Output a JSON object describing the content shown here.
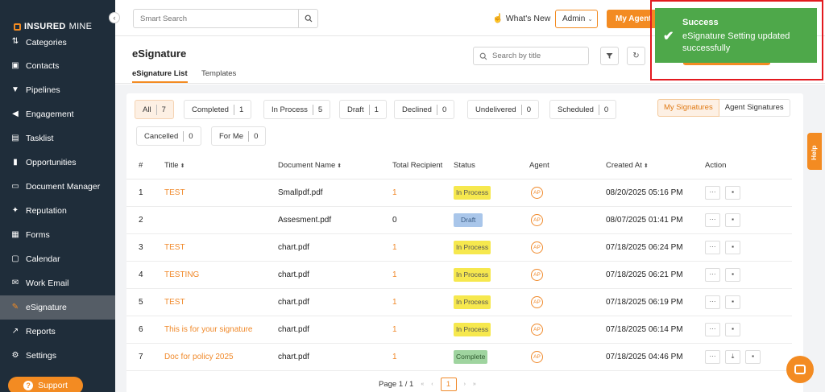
{
  "brand": {
    "name_bold": "INSURED",
    "name_light": "MINE"
  },
  "sidebar": {
    "collapse_icon": "chevron-left-icon",
    "items": [
      {
        "label": "Categories",
        "icon": "arrows-icon"
      },
      {
        "label": "Contacts",
        "icon": "contact-card-icon"
      },
      {
        "label": "Pipelines",
        "icon": "funnel-icon"
      },
      {
        "label": "Engagement",
        "icon": "megaphone-icon"
      },
      {
        "label": "Tasklist",
        "icon": "clipboard-icon"
      },
      {
        "label": "Opportunities",
        "icon": "bar-chart-icon"
      },
      {
        "label": "Document Manager",
        "icon": "folder-icon"
      },
      {
        "label": "Reputation",
        "icon": "star-person-icon"
      },
      {
        "label": "Forms",
        "icon": "form-icon"
      },
      {
        "label": "Calendar",
        "icon": "calendar-icon"
      },
      {
        "label": "Work Email",
        "icon": "envelope-icon"
      },
      {
        "label": "eSignature",
        "icon": "signature-icon",
        "active": true
      },
      {
        "label": "Reports",
        "icon": "line-chart-icon"
      },
      {
        "label": "Settings",
        "icon": "gear-icon"
      }
    ],
    "support_label": "Support"
  },
  "topbar": {
    "search_placeholder": "Smart Search",
    "whats_new": "What's New",
    "admin_select": "Admin",
    "my_agent": "My Agent"
  },
  "page": {
    "title": "eSignature",
    "tabs": [
      "eSignature List",
      "Templates"
    ],
    "search_placeholder": "Search by title"
  },
  "filters": [
    {
      "label": "All",
      "count": "7",
      "active": true
    },
    {
      "label": "Completed",
      "count": "1"
    },
    {
      "label": "In Process",
      "count": "5"
    },
    {
      "label": "Draft",
      "count": "1"
    },
    {
      "label": "Declined",
      "count": "0"
    },
    {
      "label": "Undelivered",
      "count": "0"
    },
    {
      "label": "Scheduled",
      "count": "0"
    },
    {
      "label": "Cancelled",
      "count": "0"
    },
    {
      "label": "For Me",
      "count": "0"
    }
  ],
  "toggles": {
    "my": "My Signatures",
    "agent": "Agent Signatures"
  },
  "table": {
    "headers": [
      "#",
      "Title",
      "Document Name",
      "Total Recipient",
      "Status",
      "Agent",
      "Created At",
      "Action"
    ],
    "rows": [
      {
        "num": "1",
        "title": "TEST",
        "doc": "Smallpdf.pdf",
        "recipients": "1",
        "status": "In Process",
        "agent": "AP",
        "created": "08/20/2025 05:16 PM"
      },
      {
        "num": "2",
        "title": "",
        "doc": "Assesment.pdf",
        "recipients": "0",
        "status": "Draft",
        "agent": "AP",
        "created": "08/07/2025 01:41 PM"
      },
      {
        "num": "3",
        "title": "TEST",
        "doc": "chart.pdf",
        "recipients": "1",
        "status": "In Process",
        "agent": "AP",
        "created": "07/18/2025 06:24 PM"
      },
      {
        "num": "4",
        "title": "TESTING",
        "doc": "chart.pdf",
        "recipients": "1",
        "status": "In Process",
        "agent": "AP",
        "created": "07/18/2025 06:21 PM"
      },
      {
        "num": "5",
        "title": "TEST",
        "doc": "chart.pdf",
        "recipients": "1",
        "status": "In Process",
        "agent": "AP",
        "created": "07/18/2025 06:19 PM"
      },
      {
        "num": "6",
        "title": "This is for your signature",
        "doc": "chart.pdf",
        "recipients": "1",
        "status": "In Process",
        "agent": "AP",
        "created": "07/18/2025 06:14 PM"
      },
      {
        "num": "7",
        "title": "Doc for policy 2025",
        "doc": "chart.pdf",
        "recipients": "1",
        "status": "Complete",
        "agent": "AP",
        "created": "07/18/2025 04:46 PM"
      }
    ]
  },
  "pagination": {
    "label": "Page 1 / 1",
    "current": "1"
  },
  "toast": {
    "title": "Success",
    "message": "eSignature Setting updated successfully"
  },
  "help_label": "Help",
  "colors": {
    "accent": "#f38b22",
    "sidebar": "#1f2d3a",
    "success": "#4ea84a",
    "highlight_frame": "#e3191e"
  }
}
